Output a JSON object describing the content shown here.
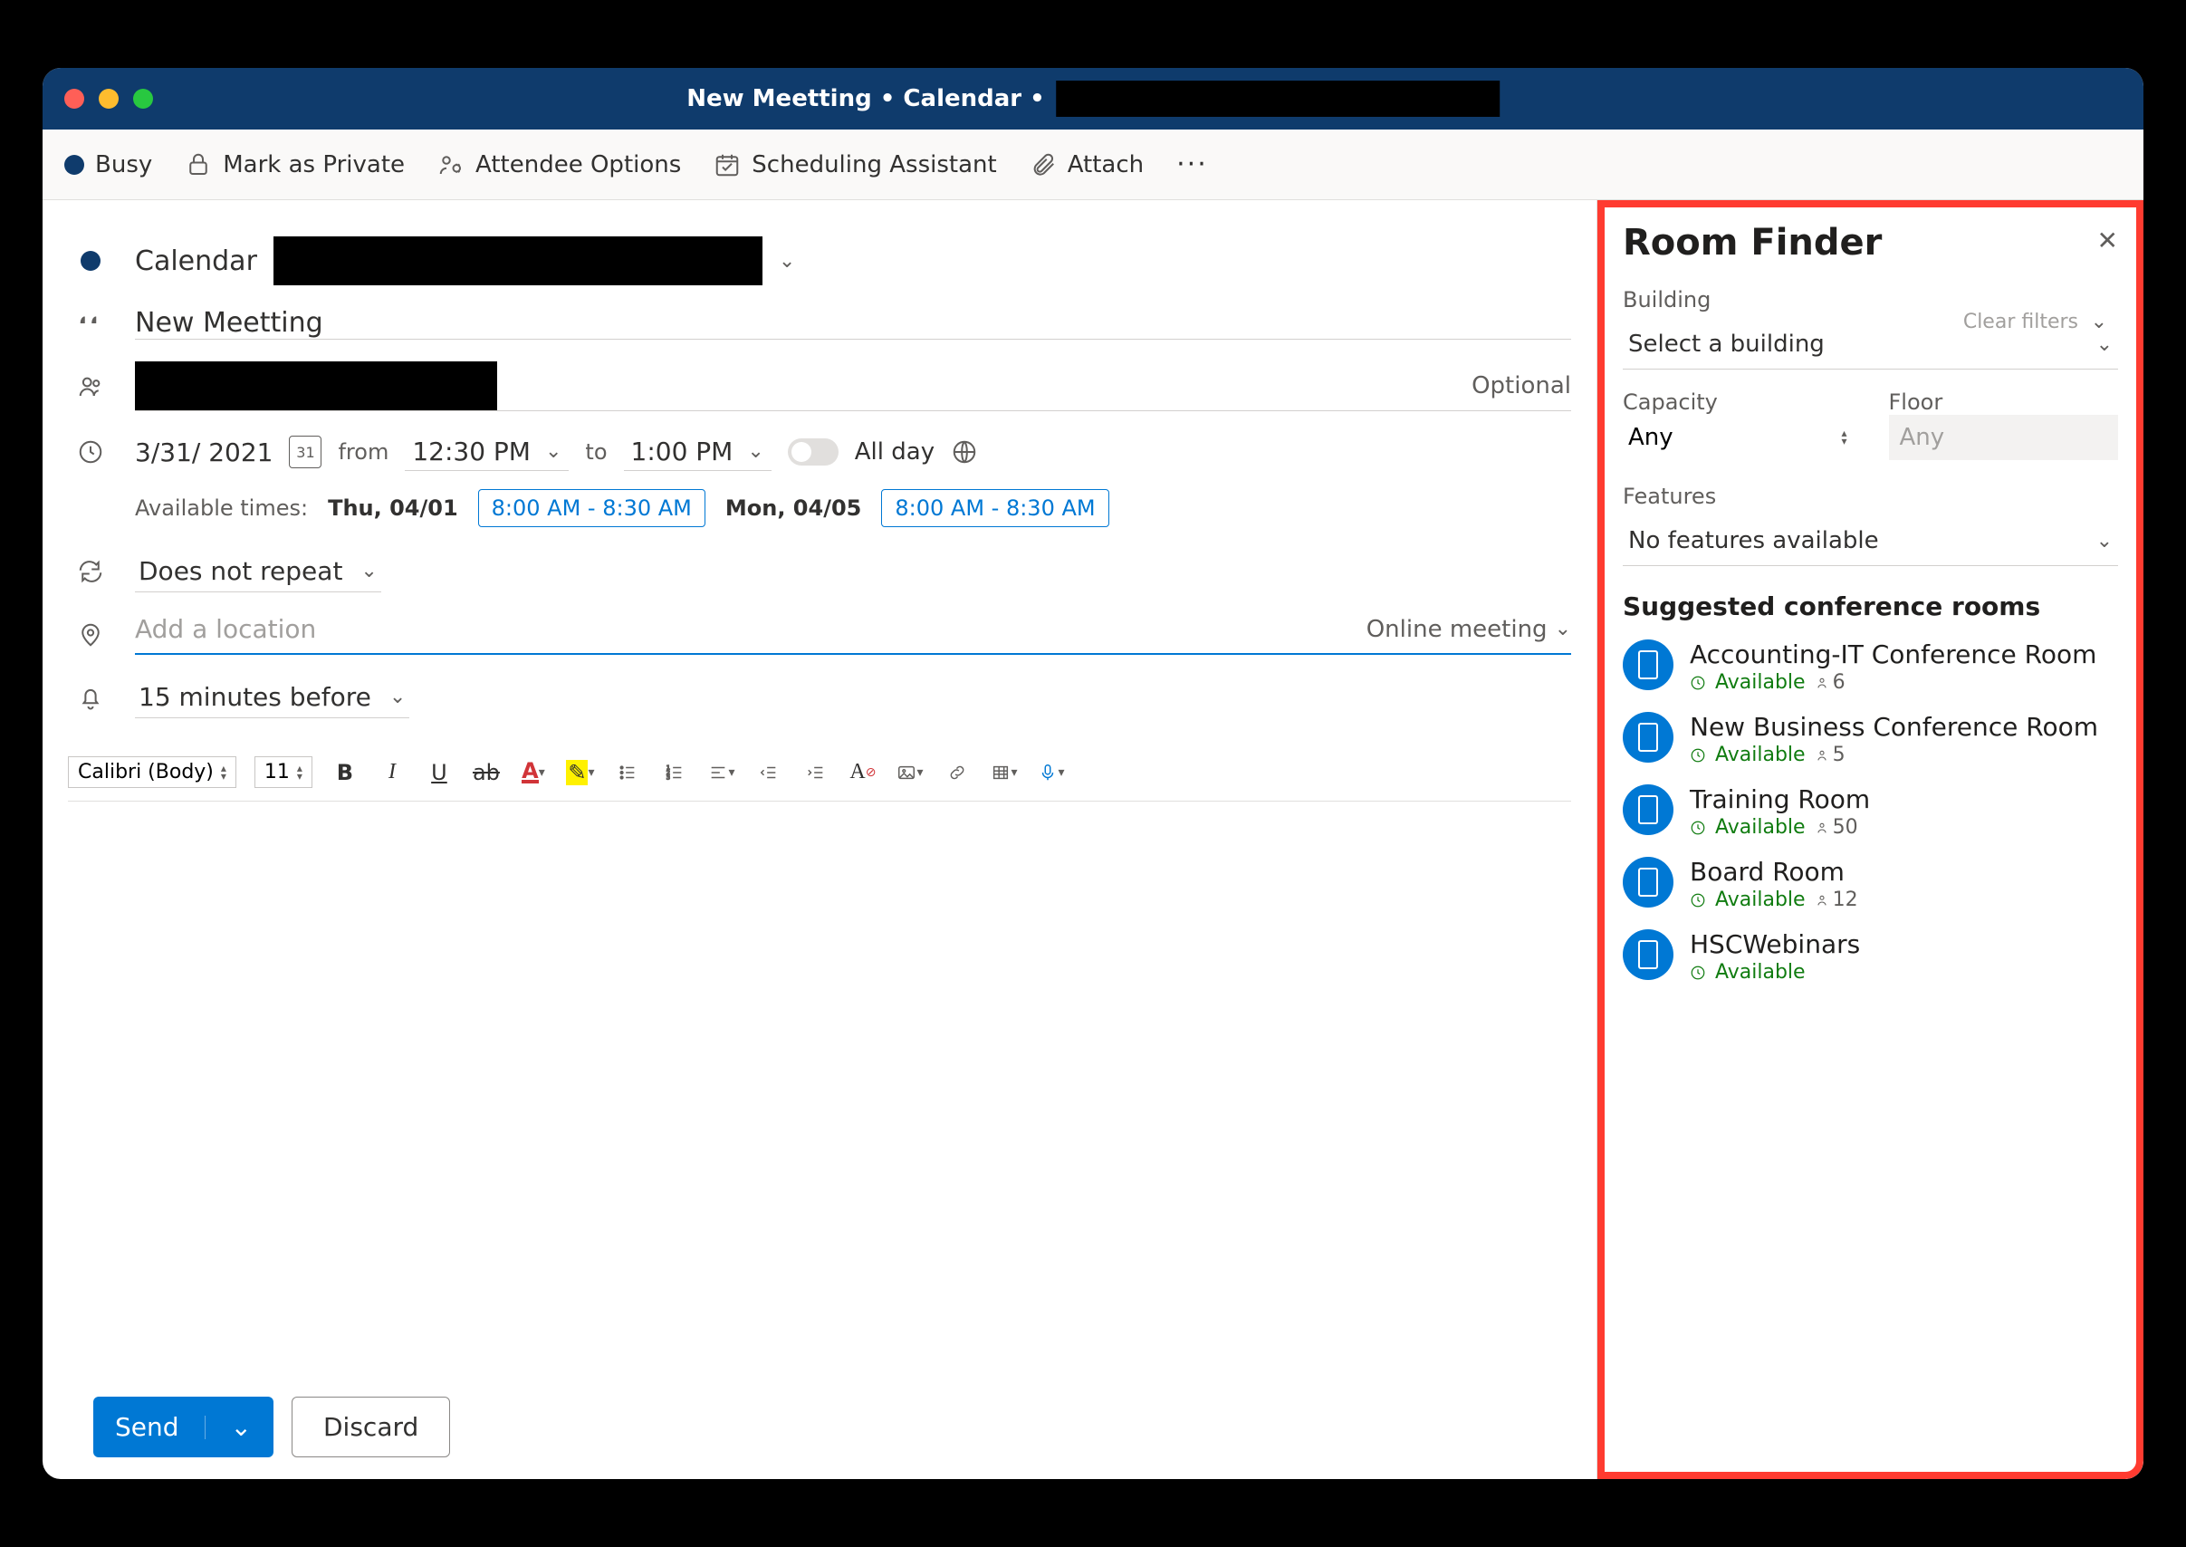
{
  "window": {
    "title_prefix": "New Meetting • Calendar •"
  },
  "toolbar": {
    "status": "Busy",
    "private": "Mark as Private",
    "attendee": "Attendee Options",
    "scheduling": "Scheduling Assistant",
    "attach": "Attach"
  },
  "form": {
    "calendar_label": "Calendar",
    "title": "New Meetting",
    "optional": "Optional",
    "date": "3/31/ 2021",
    "from_label": "from",
    "from_time": "12:30 PM",
    "to_label": "to",
    "to_time": "1:00 PM",
    "allday": "All day",
    "available_label": "Available times:",
    "avail1_date": "Thu, 04/01",
    "avail1_slot": "8:00 AM - 8:30 AM",
    "avail2_date": "Mon, 04/05",
    "avail2_slot": "8:00 AM - 8:30 AM",
    "repeat": "Does not repeat",
    "location_placeholder": "Add a location",
    "online_meeting": "Online meeting",
    "reminder": "15 minutes before"
  },
  "editor": {
    "font": "Calibri (Body)",
    "size": "11"
  },
  "footer": {
    "send": "Send",
    "discard": "Discard"
  },
  "room_finder": {
    "title": "Room Finder",
    "building_label": "Building",
    "clear_filters": "Clear filters",
    "building_select": "Select a building",
    "capacity_label": "Capacity",
    "capacity_value": "Any",
    "floor_label": "Floor",
    "floor_value": "Any",
    "features_label": "Features",
    "features_value": "No features available",
    "suggested_label": "Suggested conference rooms",
    "rooms": [
      {
        "name": "Accounting-IT Conference Room",
        "status": "Available",
        "capacity": "6"
      },
      {
        "name": "New Business Conference Room",
        "status": "Available",
        "capacity": "5"
      },
      {
        "name": "Training Room",
        "status": "Available",
        "capacity": "50"
      },
      {
        "name": "Board Room",
        "status": "Available",
        "capacity": "12"
      },
      {
        "name": "HSCWebinars",
        "status": "Available",
        "capacity": ""
      }
    ]
  }
}
